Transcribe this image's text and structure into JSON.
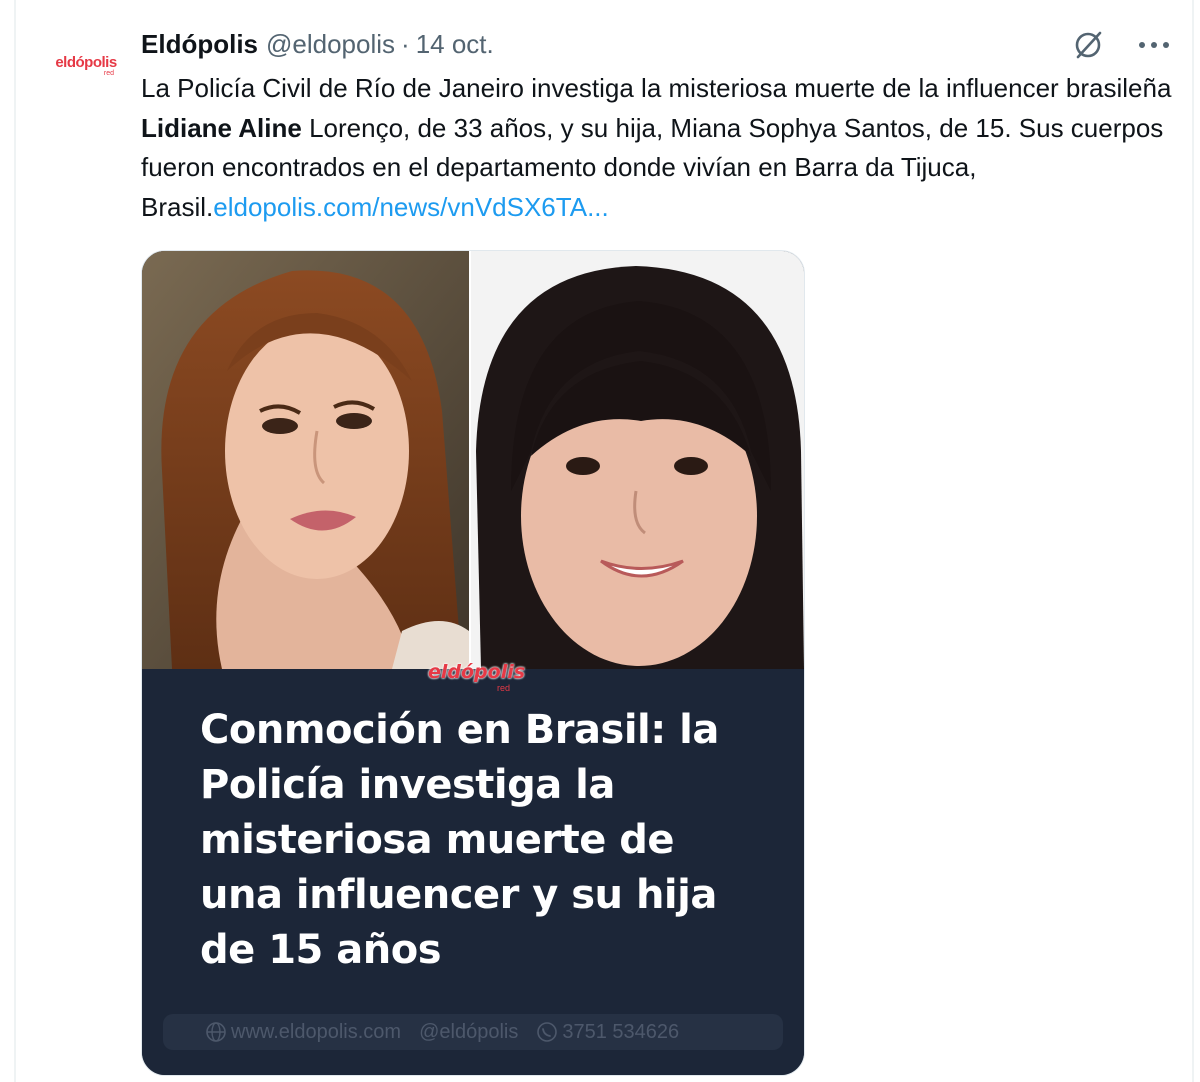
{
  "tweet": {
    "avatar": {
      "brand": "eldópolis",
      "brand_sub": "red"
    },
    "author_name": "Eldópolis",
    "author_handle": "@eldopolis",
    "separator": "·",
    "date": "14 oct.",
    "text": {
      "part1": "La Policía Civil de Río de Janeiro investiga la misteriosa muerte de la influencer brasileña ",
      "bold": "Lidiane Aline",
      "part2": " Lorenço, de 33 años, y su hija, Miana Sophya Santos, de 15. Sus cuerpos fueron encontrados en el departamento donde vivían en Barra da Tijuca, Brasil.",
      "link": "eldopolis.com/news/vnVdSX6TA..."
    },
    "icons": {
      "grok": "grok-icon",
      "more": "more-icon"
    }
  },
  "card": {
    "brand": "eldópolis",
    "brand_sub": "red",
    "headline": "Conmoción en Brasil: la Policía investiga la misteriosa muerte de una influencer y su hija de 15 años",
    "footer": {
      "website": "www.eldopolis.com",
      "social": "@eldópolis",
      "phone": "3751 534626"
    }
  },
  "colors": {
    "link": "#1d9bf0",
    "muted": "#536471",
    "card_bg": "#1c2638",
    "brand_red": "#e63946"
  }
}
